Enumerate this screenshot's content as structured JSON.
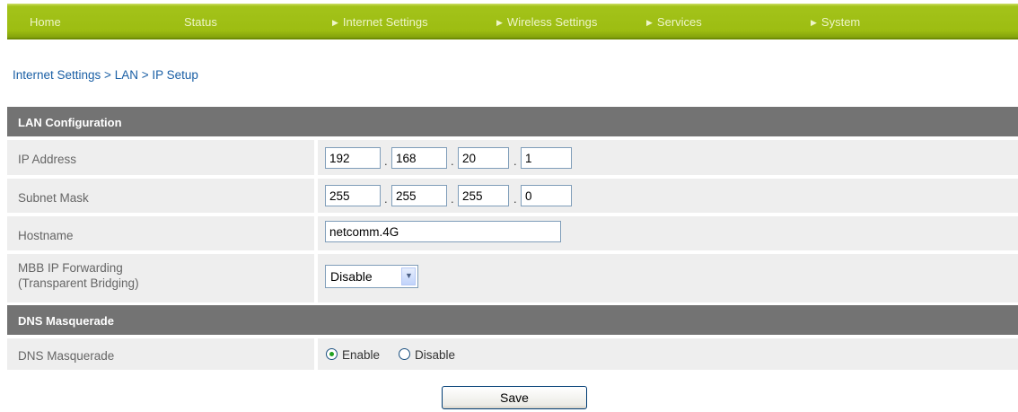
{
  "nav": {
    "items": [
      {
        "label": "Home",
        "arrow": false
      },
      {
        "label": "Status",
        "arrow": false
      },
      {
        "label": "Internet Settings",
        "arrow": true
      },
      {
        "label": "Wireless Settings",
        "arrow": true
      },
      {
        "label": "Services",
        "arrow": true
      },
      {
        "label": "System",
        "arrow": true
      }
    ]
  },
  "breadcrumb": "Internet Settings > LAN > IP Setup",
  "lan": {
    "header": "LAN Configuration",
    "ip_label": "IP Address",
    "ip": [
      "192",
      "168",
      "20",
      "1"
    ],
    "subnet_label": "Subnet Mask",
    "subnet": [
      "255",
      "255",
      "255",
      "0"
    ],
    "hostname_label": "Hostname",
    "hostname": "netcomm.4G",
    "mbb_label_1": "MBB IP Forwarding",
    "mbb_label_2": "(Transparent Bridging)",
    "mbb_value": "Disable"
  },
  "dns": {
    "header": "DNS Masquerade",
    "label": "DNS Masquerade",
    "enable_label": "Enable",
    "disable_label": "Disable",
    "selected": "Enable"
  },
  "save_label": "Save",
  "colors": {
    "nav_green": "#9dbd12",
    "section_header": "#737373",
    "row_bg": "#eeeeee",
    "breadcrumb_link": "#1a5fa5"
  }
}
